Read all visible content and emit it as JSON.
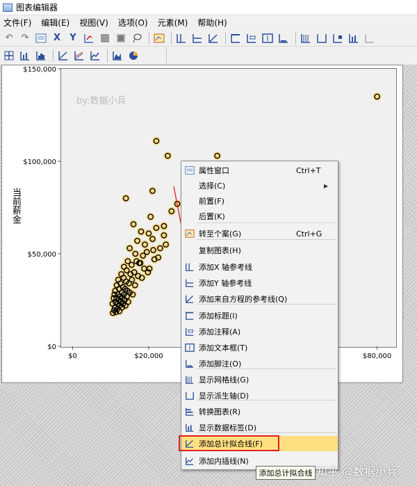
{
  "window": {
    "title": "图表编辑器"
  },
  "menubar": [
    "文件(F)",
    "编辑(E)",
    "视图(V)",
    "选项(O)",
    "元素(M)",
    "帮助(H)"
  ],
  "toolbar1_icons": [
    "undo-icon",
    "redo-icon",
    "properties-icon",
    "x-axis-select-icon",
    "y-axis-select-icon",
    "chart-edit-icon",
    "fill-icon",
    "lasso-icon",
    "case-icon",
    "x-ref-line-icon",
    "y-ref-line-icon",
    "equation-line-icon",
    "title-icon",
    "annotation-icon",
    "textbox-icon",
    "footnote-icon",
    "grid-icon",
    "derived-axis-icon",
    "legend-icon",
    "data-label-icon"
  ],
  "toolbar2_icons": [
    "show-axis-icon",
    "bar-chart-icon",
    "histogram-icon",
    "fit-line-total-icon",
    "fit-line-subgroup-icon",
    "interp-line-icon",
    "area-icon",
    "pie-icon"
  ],
  "watermark": "by:数据小兵",
  "corner_watermark": "知乎 @数据小兵",
  "context_menu": {
    "items": [
      {
        "label": "属性窗口",
        "shortcut": "Ctrl+T",
        "icon": "properties-icon"
      },
      {
        "label": "选择(C)",
        "submenu": true
      },
      {
        "label": "前置(F)"
      },
      {
        "label": "后置(K)"
      },
      {
        "label": "转至个案(G)",
        "shortcut": "Ctrl+G",
        "icon": "go-to-case-icon"
      },
      {
        "label": "复制图表(H)"
      },
      {
        "label": "添加X 轴参考线",
        "icon": "x-ref-line-icon"
      },
      {
        "label": "添加Y 轴参考线",
        "icon": "y-ref-line-icon"
      },
      {
        "label": "添加来自方程的参考线(Q)",
        "icon": "equation-line-icon"
      },
      {
        "label": "添加标题(I)",
        "icon": "title-icon"
      },
      {
        "label": "添加注释(A)",
        "icon": "annotation-icon"
      },
      {
        "label": "添加文本框(T)",
        "icon": "textbox-icon"
      },
      {
        "label": "添加脚注(O)",
        "icon": "footnote-icon"
      },
      {
        "label": "显示网格线(G)",
        "icon": "grid-icon"
      },
      {
        "label": "显示派生轴(D)",
        "icon": "derived-axis-icon"
      },
      {
        "label": "转换图表(R)",
        "icon": "transpose-icon"
      },
      {
        "label": "显示数据标签(D)",
        "icon": "data-label-icon"
      },
      {
        "label": "添加总计拟合线(F)",
        "icon": "fit-line-icon",
        "highlighted": true
      },
      {
        "label": "添加内插线(N)",
        "icon": "interp-line-icon"
      }
    ]
  },
  "tooltip": "添加总计拟合线",
  "chart_data": {
    "type": "scatter",
    "ylabel": "当前薪金",
    "xlabel": "",
    "xlim": [
      -3000,
      85000
    ],
    "ylim": [
      0,
      150000
    ],
    "x_ticks": [
      "$0",
      "$20,000",
      "$80,000"
    ],
    "y_ticks": [
      "$0",
      "$50,000",
      "$100,000",
      "$150,000"
    ],
    "grid": false,
    "point_color": "#000000",
    "selection_color": "#f6d98a",
    "highlight_color": "#ffe080",
    "series": [
      {
        "x": [
          80000,
          22000,
          25000,
          38000,
          14000,
          21000,
          20500,
          24000,
          26000,
          27500,
          16000,
          18000,
          20000,
          22000,
          24000,
          17000,
          19000,
          21000,
          23000,
          15000,
          16500,
          18500,
          19500,
          21500,
          22500,
          14500,
          15500,
          17500,
          20200,
          13500,
          14200,
          15200,
          16200,
          17200,
          18200,
          12800,
          13400,
          14100,
          14800,
          15600,
          16400,
          12000,
          12600,
          13200,
          13800,
          14400,
          15000,
          15800,
          11600,
          12200,
          12900,
          13500,
          14300,
          11200,
          11900,
          12500,
          13100,
          13700,
          14600,
          11000,
          11500,
          12100,
          12700,
          13300,
          13900,
          10800,
          11300,
          11800,
          12400,
          13000,
          10500,
          11100,
          11700,
          12300,
          10900,
          11400,
          10600,
          17800,
          18800,
          19800,
          16800,
          21200,
          24500
        ],
        "y": [
          135000,
          111000,
          103000,
          103000,
          80000,
          84000,
          70000,
          65000,
          73000,
          77000,
          66000,
          62000,
          61000,
          64000,
          60000,
          57000,
          55000,
          58000,
          53000,
          53000,
          50000,
          49000,
          51000,
          47000,
          48000,
          46000,
          44000,
          45000,
          42000,
          43000,
          41000,
          39000,
          40000,
          38000,
          37000,
          39000,
          37000,
          35000,
          34000,
          36000,
          33000,
          36000,
          34000,
          32000,
          31000,
          30000,
          29000,
          28000,
          33000,
          31000,
          29000,
          28000,
          27000,
          30000,
          28000,
          27000,
          26000,
          25000,
          24000,
          28000,
          26000,
          25000,
          24000,
          23000,
          22000,
          26000,
          24000,
          23000,
          22000,
          21000,
          23000,
          21000,
          20000,
          19000,
          19500,
          18500,
          18000,
          45000,
          42000,
          40000,
          46000,
          52000,
          55000
        ]
      }
    ]
  }
}
